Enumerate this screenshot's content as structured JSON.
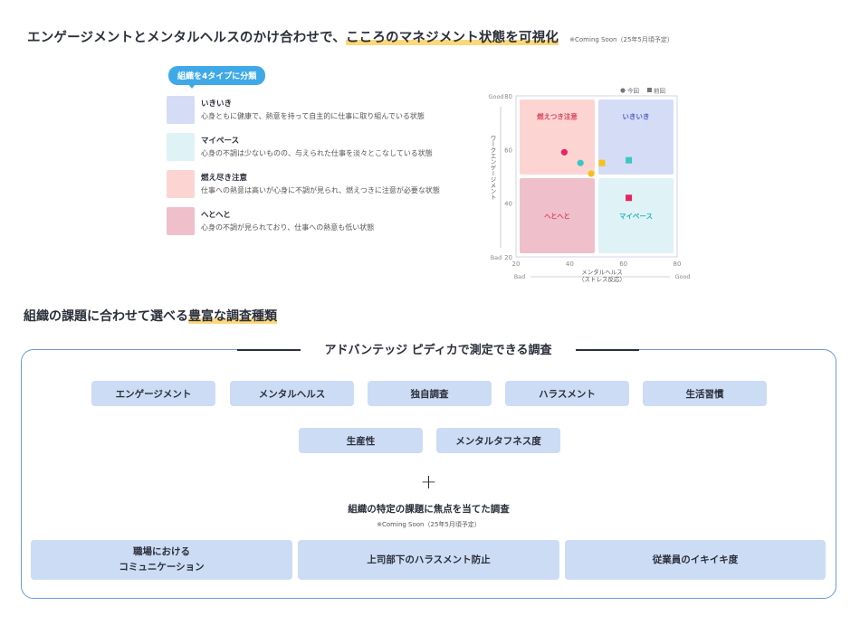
{
  "header": {
    "text_before": "エンゲージメントとメンタルヘルスのかけ合わせで、",
    "text_highlight": "こころのマネジメント状態を可視化",
    "note": "※Coming Soon（25年5月頃予定）"
  },
  "types_section": {
    "badge": "組織を4タイプに分類",
    "types": [
      {
        "name": "いきいき",
        "desc": "心身ともに健康で、熱意を持って自主的に仕事に取り組んでいる状態",
        "color": "#d5dcf6"
      },
      {
        "name": "マイペース",
        "desc": "心身の不調は少ないものの、与えられた仕事を淡々とこなしている状態",
        "color": "#dff2f6"
      },
      {
        "name": "燃え尽き注意",
        "desc": "仕事への熱意は高いが心身に不調が見られ、燃えつきに注意が必要な状態",
        "color": "#fcd5d3"
      },
      {
        "name": "へとへと",
        "desc": "心身の不調が見られており、仕事への熱意も低い状態",
        "color": "#efbfcc"
      }
    ]
  },
  "chart_data": {
    "type": "scatter",
    "legend": {
      "current": "今回",
      "previous": "前回",
      "position": "top-right"
    },
    "ylabel": "ワークエンゲージメント",
    "ylabel_top": "Good",
    "ylabel_bottom": "Bad",
    "xlabel": "メンタルヘルス\n（ストレス反応）",
    "xlabel_left": "Bad",
    "xlabel_right": "Good",
    "xlim": [
      20,
      80
    ],
    "ylim": [
      20,
      80
    ],
    "xticks": [
      "20",
      "40",
      "60",
      "80"
    ],
    "yticks": [
      "80",
      "60",
      "40",
      "20"
    ],
    "quadrants": [
      {
        "label": "燃えつき注意",
        "color": "#fcd5d3",
        "text_color": "#d9485f"
      },
      {
        "label": "いきいき",
        "color": "#d5dcf6",
        "text_color": "#4e63c8"
      },
      {
        "label": "へとへと",
        "color": "#efbfcc",
        "text_color": "#d9485f"
      },
      {
        "label": "マイペース",
        "color": "#dff2f6",
        "text_color": "#2bb3c0"
      }
    ],
    "series": [
      {
        "name": "今回",
        "marker": "circle",
        "points": [
          {
            "x": 38,
            "y": 59,
            "color": "#e8245e"
          },
          {
            "x": 44,
            "y": 55,
            "color": "#3cc6c0"
          },
          {
            "x": 48,
            "y": 51,
            "color": "#f4c21f"
          }
        ]
      },
      {
        "name": "前回",
        "marker": "square",
        "points": [
          {
            "x": 52,
            "y": 55,
            "color": "#f4c21f"
          },
          {
            "x": 62,
            "y": 56,
            "color": "#3cc6c0"
          },
          {
            "x": 62,
            "y": 42,
            "color": "#e8245e"
          }
        ]
      }
    ]
  },
  "survey_heading": {
    "text_before": "組織の課題に合わせて選べる",
    "text_highlight": "豊富な調査種類"
  },
  "survey_box": {
    "title": "アドバンテッジ ピディカで測定できる調査",
    "tags_row1": [
      "エンゲージメント",
      "メンタルヘルス",
      "独自調査",
      "ハラスメント",
      "生活習慣"
    ],
    "tags_row2": [
      "生産性",
      "メンタルタフネス度"
    ],
    "plus": "+",
    "focus_title": "組織の特定の課題に焦点を当てた調査",
    "focus_note": "※Coming Soon（25年5月頃予定）",
    "focus_tags": [
      "職場における\nコミュニケーション",
      "上司部下のハラスメント防止",
      "従業員のイキイキ度"
    ]
  }
}
